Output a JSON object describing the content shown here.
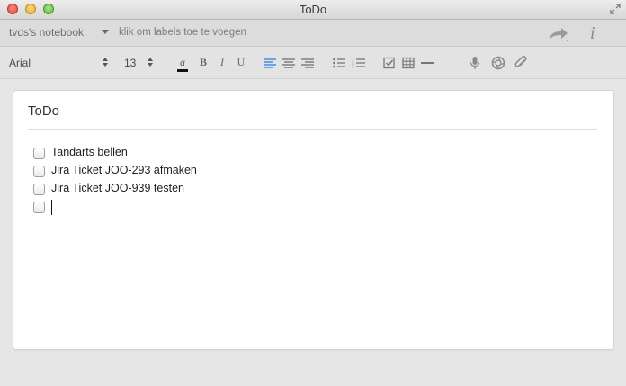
{
  "window": {
    "title": "ToDo"
  },
  "toolbar1": {
    "notebook_name": "tvds's notebook",
    "tags_placeholder": "klik om labels toe te voegen",
    "share_icon": "share-arrow-icon",
    "info_icon": "info-icon"
  },
  "format_toolbar": {
    "font_family": "Arial",
    "font_size": "13",
    "accent_color": "#3b86d8",
    "buttons": [
      "text-color",
      "bold",
      "italic",
      "underline",
      "align-left",
      "align-center",
      "align-right",
      "bullet-list",
      "numbered-list",
      "checkbox",
      "table",
      "horizontal-rule",
      "microphone",
      "camera",
      "attachment"
    ],
    "labels": {
      "bold": "B",
      "italic": "I",
      "underline": "U",
      "text_color": "a"
    }
  },
  "note": {
    "title": "ToDo",
    "todos": [
      {
        "text": "Tandarts bellen",
        "checked": false
      },
      {
        "text": "Jira Ticket JOO-293 afmaken",
        "checked": false
      },
      {
        "text": "Jira Ticket JOO-939 testen",
        "checked": false
      },
      {
        "text": "",
        "checked": false
      }
    ]
  }
}
